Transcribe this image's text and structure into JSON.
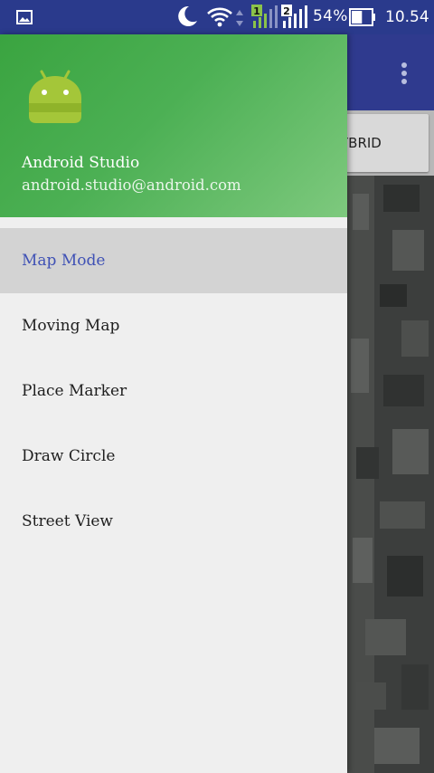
{
  "status_bar": {
    "icons": [
      "gallery-icon",
      "moon-icon",
      "wifi-icon",
      "data-arrows-icon",
      "sim1-signal-icon",
      "sim2-signal-icon",
      "battery-icon"
    ],
    "sim1_label": "1",
    "sim2_label": "2",
    "battery_percent": "54%",
    "battery_level": 0.54,
    "time": "10.54"
  },
  "app": {
    "toolbar_menu_icon": "more-vert-icon",
    "map_type_button": "YBRID",
    "colors": {
      "toolbar": "#2f3a8e",
      "status_bar": "#2a3a8c"
    }
  },
  "drawer": {
    "header": {
      "logo_icon": "android-logo",
      "user_name": "Android Studio",
      "user_email": "android.studio@android.com",
      "gradient": [
        "#3aa440",
        "#7ec97e"
      ]
    },
    "menu": [
      {
        "label": "Map Mode",
        "selected": true
      },
      {
        "label": "Moving Map",
        "selected": false
      },
      {
        "label": "Place Marker",
        "selected": false
      },
      {
        "label": "Draw Circle",
        "selected": false
      },
      {
        "label": "Street View",
        "selected": false
      }
    ],
    "selected_color": "#3f51b5"
  }
}
